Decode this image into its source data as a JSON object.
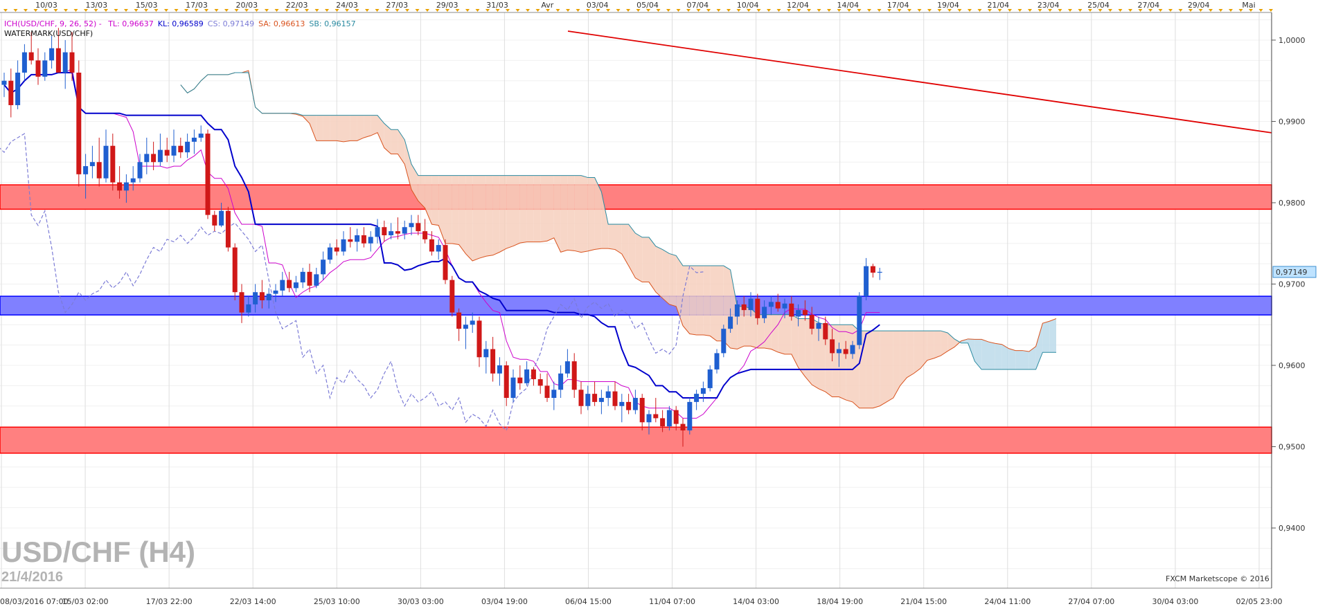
{
  "chart_data": {
    "type": "candlestick",
    "title": "USD/CHF (H4)",
    "subtitle": "21/4/2016",
    "credit": "FXCM Marketscope © 2016",
    "last_price": "0,97149",
    "y_ticks": [
      "1,0000",
      "0,9900",
      "0,9800",
      "0,9700",
      "0,9600",
      "0,9500",
      "0,9400"
    ],
    "ylim": [
      0.9326,
      1.0034
    ],
    "top_labels": [
      "10/03",
      "13/03",
      "15/03",
      "17/03",
      "20/03",
      "22/03",
      "24/03",
      "27/03",
      "29/03",
      "31/03",
      "Avr",
      "03/04",
      "05/04",
      "07/04",
      "10/04",
      "12/04",
      "14/04",
      "17/04",
      "19/04",
      "21/04",
      "23/04",
      "25/04",
      "27/04",
      "29/04",
      "Mai"
    ],
    "bottom_labels": [
      "08/03/2016 07:00",
      "15/03 02:00",
      "17/03 22:00",
      "22/03 14:00",
      "25/03 10:00",
      "30/03 03:00",
      "03/04 19:00",
      "06/04 15:00",
      "11/04 07:00",
      "14/04 03:00",
      "18/04 19:00",
      "21/04 15:00",
      "24/04 11:00",
      "27/04 07:00",
      "30/04 03:00",
      "02/05 23:00"
    ],
    "indicators": {
      "line1": [
        {
          "text": "ICH(USD/CHF, 9, 26, 52) - ",
          "color": "#cc00cc"
        },
        {
          "text": "TL: 0,96637",
          "color": "#cc00cc"
        },
        {
          "text": "KL: 0,96589",
          "color": "#0000cc"
        },
        {
          "text": "CS: 0,97149",
          "color": "#7b7bd6"
        },
        {
          "text": "SA: 0,96613",
          "color": "#d9531e"
        },
        {
          "text": "SB: 0,96157",
          "color": "#2a8aa0"
        }
      ],
      "line2": "WATERMARK(USD/CHF)"
    },
    "zones": [
      {
        "name": "resistance-zone",
        "from": 0.9792,
        "to": 0.9822,
        "color": "#ff8080"
      },
      {
        "name": "pivot-zone",
        "from": 0.9662,
        "to": 0.9685,
        "color": "#8080ff"
      },
      {
        "name": "support-zone",
        "from": 0.9492,
        "to": 0.9524,
        "color": "#ff8080"
      }
    ],
    "trendline": {
      "from": [
        0,
        1.0011
      ],
      "to": [
        1,
        0.9886
      ],
      "color": "#e00000"
    },
    "candles": [
      [
        0.9945,
        0.996,
        0.993,
        0.995
      ],
      [
        0.995,
        0.9965,
        0.9905,
        0.992
      ],
      [
        0.992,
        0.9975,
        0.9915,
        0.996
      ],
      [
        0.996,
        0.9995,
        0.995,
        0.9985
      ],
      [
        0.9985,
        1.001,
        0.997,
        0.9975
      ],
      [
        0.9975,
        0.999,
        0.9945,
        0.9955
      ],
      [
        0.9955,
        0.9985,
        0.995,
        0.9975
      ],
      [
        0.9975,
        1.0005,
        0.9965,
        0.999
      ],
      [
        0.999,
        1.0015,
        0.9985,
        0.996
      ],
      [
        0.996,
        1.0,
        0.994,
        0.9985
      ],
      [
        0.9985,
        1.001,
        0.995,
        0.996
      ],
      [
        0.996,
        0.9975,
        0.982,
        0.9835
      ],
      [
        0.9835,
        0.986,
        0.9805,
        0.9845
      ],
      [
        0.9845,
        0.987,
        0.983,
        0.985
      ],
      [
        0.985,
        0.988,
        0.982,
        0.983
      ],
      [
        0.983,
        0.989,
        0.9825,
        0.987
      ],
      [
        0.987,
        0.9885,
        0.9815,
        0.9825
      ],
      [
        0.9825,
        0.9845,
        0.9805,
        0.9815
      ],
      [
        0.9815,
        0.9835,
        0.98,
        0.9825
      ],
      [
        0.9825,
        0.9845,
        0.9815,
        0.983
      ],
      [
        0.983,
        0.986,
        0.9825,
        0.985
      ],
      [
        0.985,
        0.988,
        0.9835,
        0.986
      ],
      [
        0.986,
        0.9875,
        0.984,
        0.985
      ],
      [
        0.985,
        0.9885,
        0.9845,
        0.9865
      ],
      [
        0.9865,
        0.988,
        0.985,
        0.9858
      ],
      [
        0.9858,
        0.989,
        0.985,
        0.987
      ],
      [
        0.987,
        0.988,
        0.9855,
        0.9862
      ],
      [
        0.9862,
        0.9885,
        0.9855,
        0.9875
      ],
      [
        0.9875,
        0.989,
        0.986,
        0.988
      ],
      [
        0.988,
        0.9895,
        0.9875,
        0.9885
      ],
      [
        0.9885,
        0.989,
        0.978,
        0.9785
      ],
      [
        0.9785,
        0.979,
        0.9765,
        0.9772
      ],
      [
        0.9772,
        0.98,
        0.977,
        0.979
      ],
      [
        0.979,
        0.9795,
        0.974,
        0.9745
      ],
      [
        0.9745,
        0.975,
        0.968,
        0.969
      ],
      [
        0.969,
        0.97,
        0.9652,
        0.9665
      ],
      [
        0.9665,
        0.9685,
        0.966,
        0.9675
      ],
      [
        0.9675,
        0.97,
        0.9665,
        0.969
      ],
      [
        0.969,
        0.9705,
        0.967,
        0.968
      ],
      [
        0.968,
        0.9695,
        0.967,
        0.9688
      ],
      [
        0.9688,
        0.97,
        0.9678,
        0.9692
      ],
      [
        0.9692,
        0.9715,
        0.9685,
        0.9705
      ],
      [
        0.9705,
        0.9715,
        0.969,
        0.9695
      ],
      [
        0.9695,
        0.971,
        0.969,
        0.9702
      ],
      [
        0.9702,
        0.972,
        0.9695,
        0.9715
      ],
      [
        0.9715,
        0.9725,
        0.969,
        0.9698
      ],
      [
        0.9698,
        0.972,
        0.9695,
        0.9712
      ],
      [
        0.9712,
        0.974,
        0.9705,
        0.973
      ],
      [
        0.973,
        0.975,
        0.9725,
        0.9745
      ],
      [
        0.9745,
        0.9755,
        0.9735,
        0.974
      ],
      [
        0.974,
        0.9765,
        0.9735,
        0.9755
      ],
      [
        0.9755,
        0.977,
        0.9745,
        0.9752
      ],
      [
        0.9752,
        0.9768,
        0.974,
        0.976
      ],
      [
        0.976,
        0.977,
        0.9745,
        0.975
      ],
      [
        0.975,
        0.9765,
        0.974,
        0.9758
      ],
      [
        0.9758,
        0.978,
        0.975,
        0.977
      ],
      [
        0.977,
        0.9778,
        0.9752,
        0.976
      ],
      [
        0.976,
        0.9775,
        0.9755,
        0.9765
      ],
      [
        0.9765,
        0.9782,
        0.9755,
        0.9762
      ],
      [
        0.9762,
        0.9778,
        0.9755,
        0.977
      ],
      [
        0.977,
        0.9785,
        0.976,
        0.9775
      ],
      [
        0.9775,
        0.9785,
        0.976,
        0.9765
      ],
      [
        0.9765,
        0.978,
        0.975,
        0.9755
      ],
      [
        0.9755,
        0.9765,
        0.9735,
        0.974
      ],
      [
        0.974,
        0.9755,
        0.973,
        0.9748
      ],
      [
        0.9748,
        0.9755,
        0.97,
        0.9705
      ],
      [
        0.9705,
        0.971,
        0.966,
        0.9665
      ],
      [
        0.9665,
        0.967,
        0.963,
        0.9645
      ],
      [
        0.9645,
        0.966,
        0.962,
        0.965
      ],
      [
        0.965,
        0.9665,
        0.964,
        0.9655
      ],
      [
        0.9655,
        0.966,
        0.9598,
        0.961
      ],
      [
        0.961,
        0.963,
        0.959,
        0.962
      ],
      [
        0.962,
        0.9635,
        0.958,
        0.959
      ],
      [
        0.959,
        0.961,
        0.9575,
        0.96
      ],
      [
        0.96,
        0.9605,
        0.955,
        0.956
      ],
      [
        0.956,
        0.9595,
        0.9555,
        0.9585
      ],
      [
        0.9585,
        0.96,
        0.957,
        0.9578
      ],
      [
        0.9578,
        0.9605,
        0.9575,
        0.9595
      ],
      [
        0.9595,
        0.9598,
        0.9575,
        0.9583
      ],
      [
        0.9583,
        0.959,
        0.9565,
        0.9575
      ],
      [
        0.9575,
        0.959,
        0.9555,
        0.956
      ],
      [
        0.956,
        0.958,
        0.9545,
        0.957
      ],
      [
        0.957,
        0.96,
        0.956,
        0.959
      ],
      [
        0.959,
        0.962,
        0.9585,
        0.9605
      ],
      [
        0.9605,
        0.9615,
        0.956,
        0.957
      ],
      [
        0.957,
        0.958,
        0.954,
        0.955
      ],
      [
        0.955,
        0.9575,
        0.9545,
        0.9565
      ],
      [
        0.9565,
        0.958,
        0.955,
        0.9555
      ],
      [
        0.9555,
        0.957,
        0.954,
        0.956
      ],
      [
        0.956,
        0.9575,
        0.955,
        0.9568
      ],
      [
        0.9568,
        0.958,
        0.9545,
        0.955
      ],
      [
        0.955,
        0.9565,
        0.953,
        0.9555
      ],
      [
        0.9555,
        0.9565,
        0.954,
        0.9545
      ],
      [
        0.9545,
        0.957,
        0.954,
        0.956
      ],
      [
        0.956,
        0.9565,
        0.952,
        0.953
      ],
      [
        0.953,
        0.9545,
        0.9515,
        0.954
      ],
      [
        0.954,
        0.956,
        0.953,
        0.9535
      ],
      [
        0.9535,
        0.9545,
        0.9518,
        0.9525
      ],
      [
        0.9525,
        0.955,
        0.952,
        0.9545
      ],
      [
        0.9545,
        0.955,
        0.952,
        0.9528
      ],
      [
        0.9528,
        0.9535,
        0.95,
        0.952
      ],
      [
        0.952,
        0.956,
        0.9515,
        0.9555
      ],
      [
        0.9555,
        0.957,
        0.9545,
        0.9565
      ],
      [
        0.9565,
        0.958,
        0.9555,
        0.9572
      ],
      [
        0.9572,
        0.96,
        0.9568,
        0.9595
      ],
      [
        0.9595,
        0.962,
        0.959,
        0.9615
      ],
      [
        0.9615,
        0.965,
        0.961,
        0.9645
      ],
      [
        0.9645,
        0.967,
        0.964,
        0.966
      ],
      [
        0.966,
        0.968,
        0.965,
        0.9675
      ],
      [
        0.9675,
        0.9685,
        0.966,
        0.9668
      ],
      [
        0.9668,
        0.969,
        0.966,
        0.9682
      ],
      [
        0.9682,
        0.9688,
        0.965,
        0.9658
      ],
      [
        0.9658,
        0.968,
        0.9652,
        0.9672
      ],
      [
        0.9672,
        0.9685,
        0.9662,
        0.9678
      ],
      [
        0.9678,
        0.9688,
        0.9666,
        0.967
      ],
      [
        0.967,
        0.9682,
        0.9658,
        0.9676
      ],
      [
        0.9676,
        0.9685,
        0.9655,
        0.966
      ],
      [
        0.966,
        0.9675,
        0.9648,
        0.9668
      ],
      [
        0.9668,
        0.968,
        0.9655,
        0.9662
      ],
      [
        0.9662,
        0.9672,
        0.9638,
        0.9645
      ],
      [
        0.9645,
        0.966,
        0.963,
        0.9652
      ],
      [
        0.9652,
        0.966,
        0.9625,
        0.9632
      ],
      [
        0.9632,
        0.9645,
        0.9605,
        0.9615
      ],
      [
        0.9615,
        0.9628,
        0.9598,
        0.962
      ],
      [
        0.962,
        0.963,
        0.9608,
        0.9614
      ],
      [
        0.9614,
        0.963,
        0.9608,
        0.9625
      ],
      [
        0.9625,
        0.969,
        0.962,
        0.9685
      ],
      [
        0.9685,
        0.9732,
        0.968,
        0.9722
      ],
      [
        0.9722,
        0.9725,
        0.9708,
        0.9714
      ],
      [
        0.9714,
        0.972,
        0.9705,
        0.9715
      ]
    ]
  }
}
